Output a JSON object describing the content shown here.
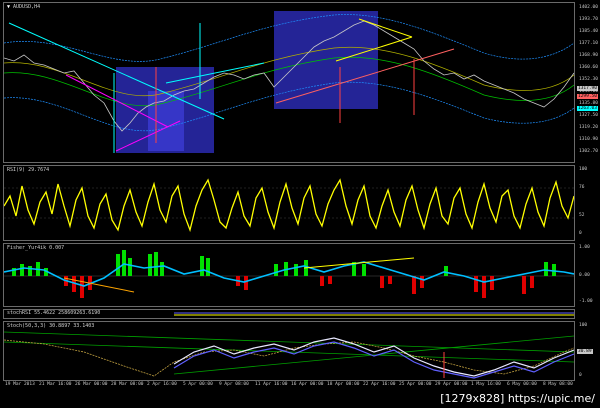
{
  "window": {
    "title": "AUDUSD,H4"
  },
  "colors": {
    "background": "#000000",
    "price_up": "#00ff00",
    "price_down": "#ff0000",
    "rsi_line": "#ffff00",
    "fisher_up": "#00ff00",
    "fisher_down": "#ff0000",
    "fisher_line": "#00bfff",
    "stoch_line": "#ffffff",
    "box_fill": "#2a2ab0",
    "trend_cyan": "#00ffff",
    "trend_magenta": "#ff00ff",
    "trend_yellow": "#ffff00"
  },
  "main_chart": {
    "scale_labels": [
      "1402.00",
      "1393.70",
      "1385.40",
      "1377.10",
      "1368.90",
      "1360.60",
      "1352.30",
      "1344.00",
      "1335.80",
      "1327.50",
      "1319.20",
      "1310.90",
      "1302.70"
    ],
    "price_tags": [
      "1317.90",
      "1263.03",
      "1299.50"
    ]
  },
  "rsi": {
    "label": "RSI(9) 29.7674",
    "scale_labels": [
      "100",
      "76",
      "52",
      "0"
    ]
  },
  "fisher": {
    "label": "Fisher_Yur4ik 0.007",
    "scale_labels": [
      "1.00",
      "0.00",
      "-1.00"
    ]
  },
  "stochrsi": {
    "label": "stochRSI 55.4622 258609263.6190"
  },
  "stoch": {
    "label": "Stoch(50,3,3) 30.8897 33.1403",
    "scale_labels": [
      "100",
      "30.89",
      "0"
    ]
  },
  "time_axis": [
    "19 Mar 2013",
    "21 Mar 16:00",
    "26 Mar 00:00",
    "28 Mar 08:00",
    "2 Apr 16:00",
    "5 Apr 00:00",
    "9 Apr 08:00",
    "11 Apr 16:00",
    "16 Apr 00:00",
    "18 Apr 08:00",
    "22 Apr 16:00",
    "25 Apr 00:00",
    "29 Apr 08:00",
    "1 May 16:00",
    "6 May 00:00",
    "8 May 08:00"
  ],
  "watermark": "[1279x828] https://upic.me/"
}
